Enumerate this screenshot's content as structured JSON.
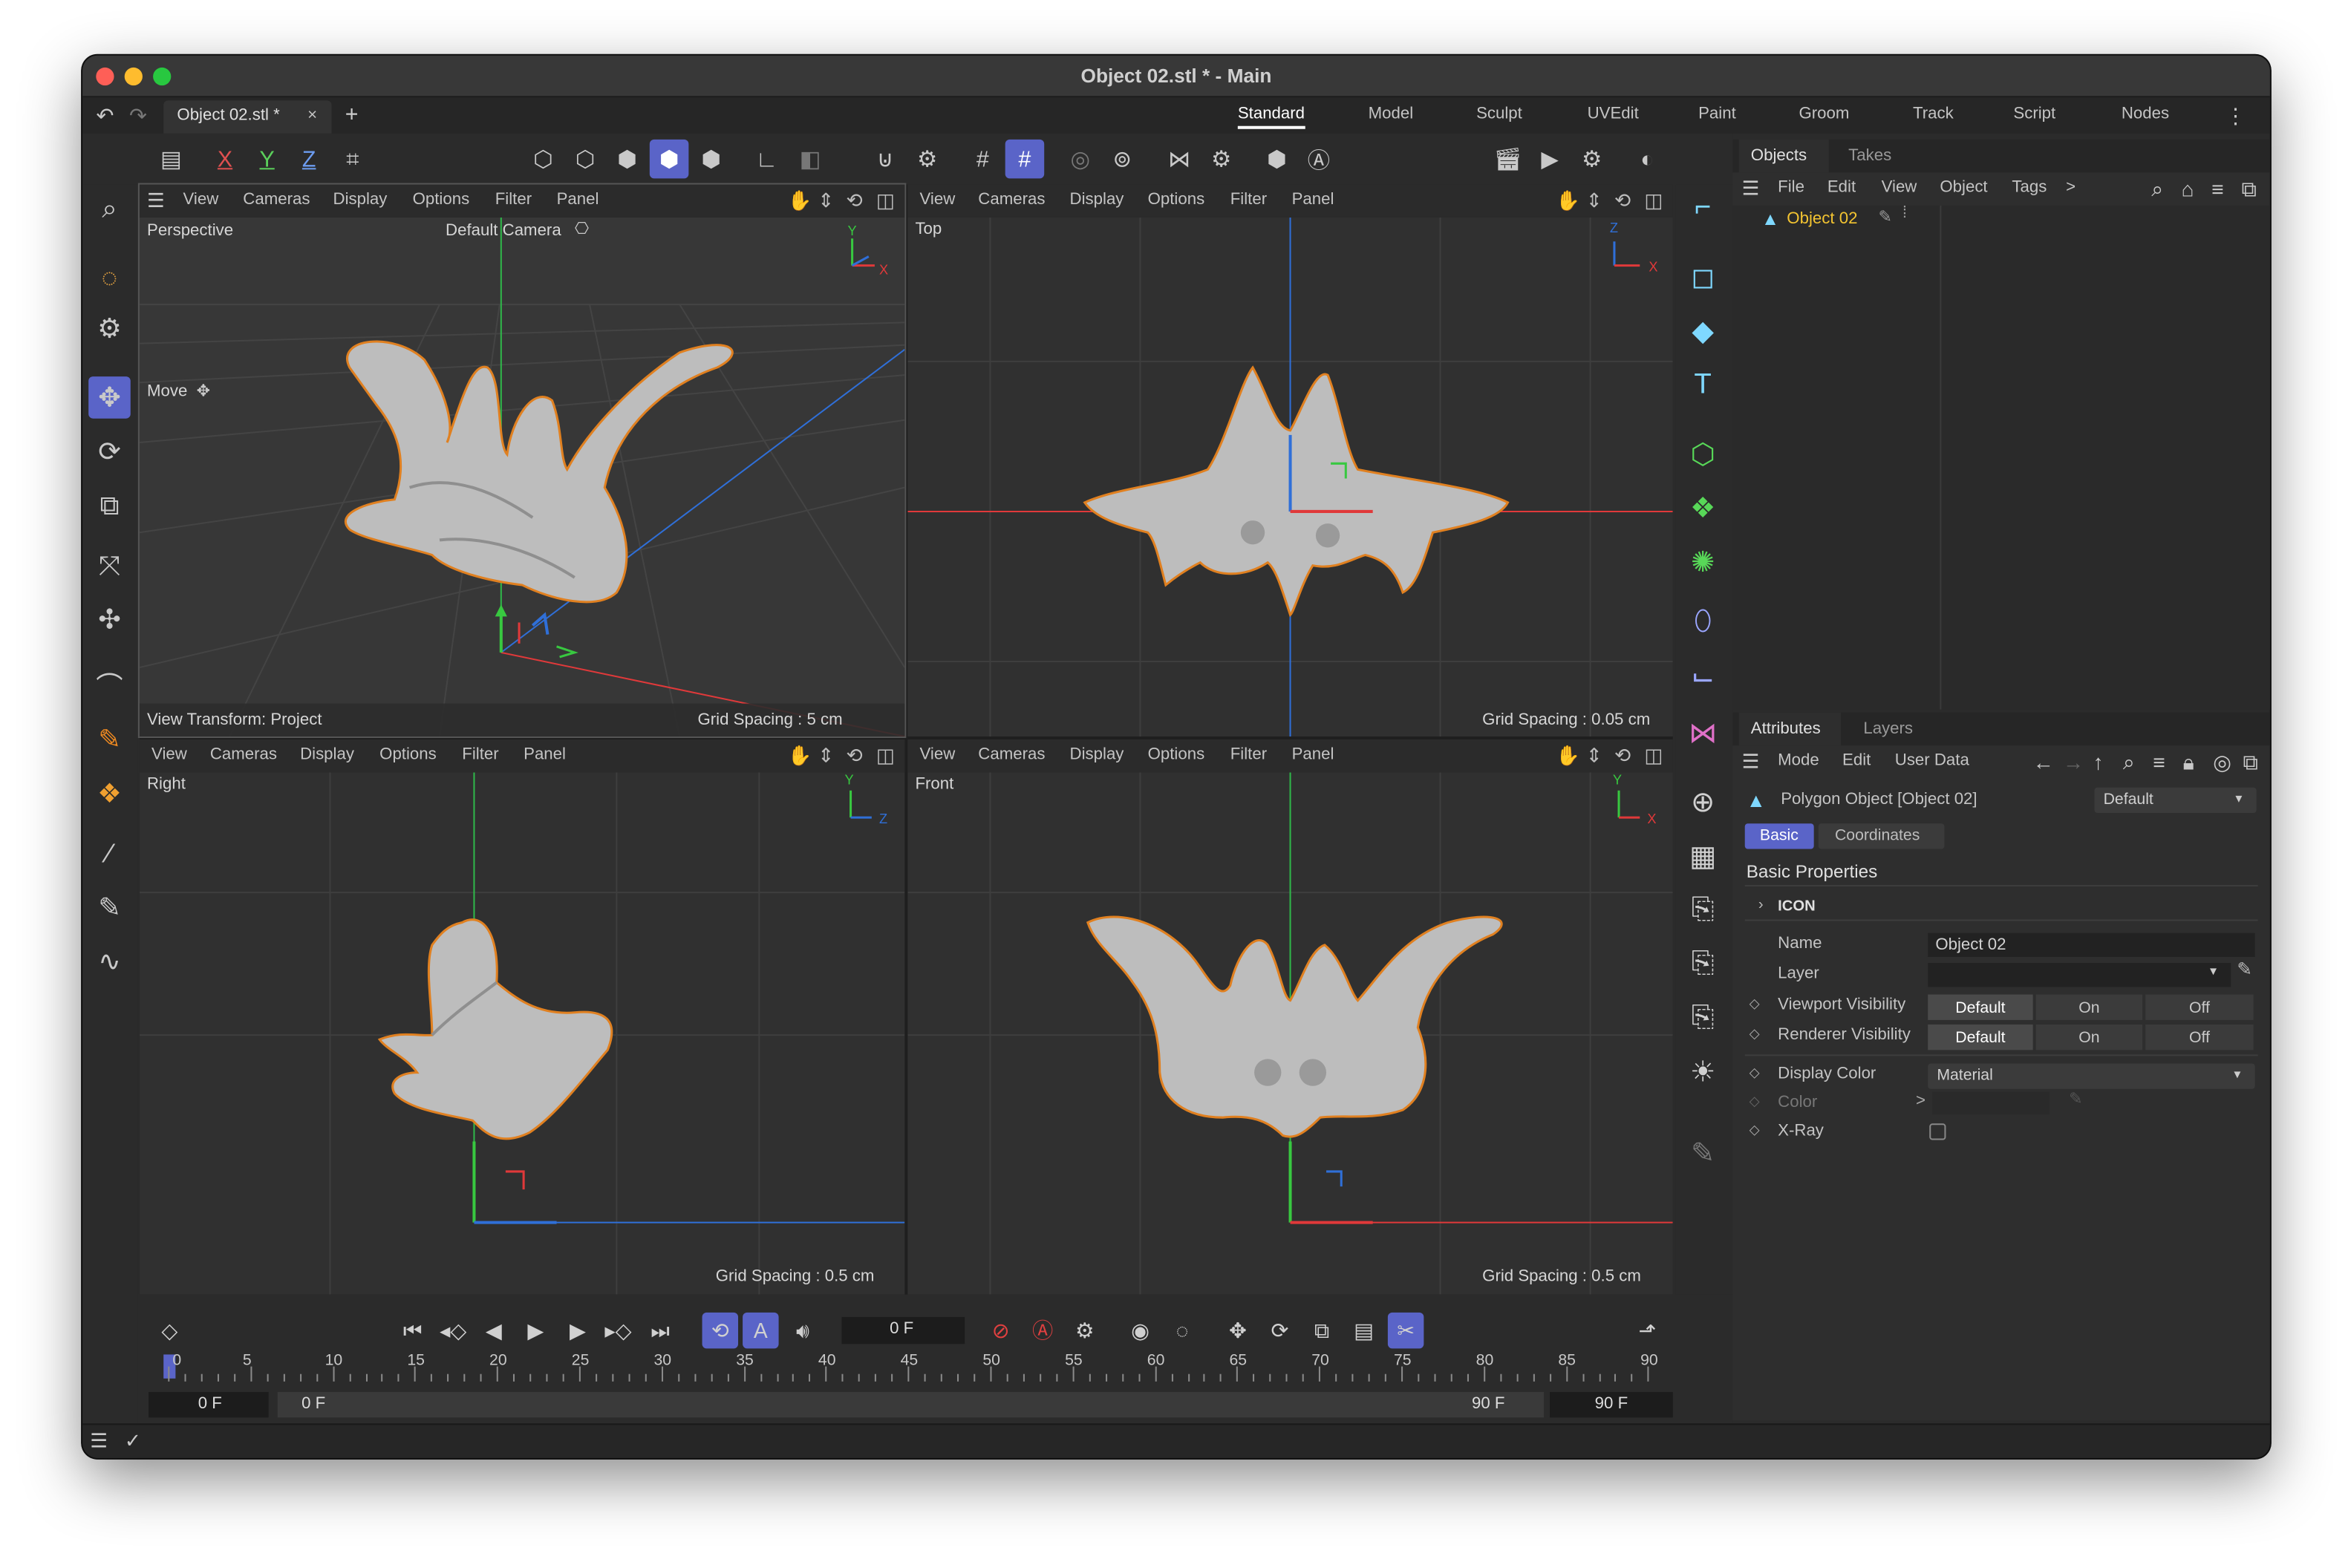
{
  "window": {
    "title": "Object 02.stl * - Main"
  },
  "tabs": {
    "doc_tab": "Object 02.stl *",
    "close": "×",
    "add": "+"
  },
  "layouts": [
    "Standard",
    "Model",
    "Sculpt",
    "UVEdit",
    "Paint",
    "Groom",
    "Track",
    "Script",
    "Nodes"
  ],
  "axis_buttons": [
    "X",
    "Y",
    "Z"
  ],
  "viewport_menu": [
    "View",
    "Cameras",
    "Display",
    "Options",
    "Filter",
    "Panel"
  ],
  "viewports": {
    "perspective": {
      "name": "Perspective",
      "camera": "Default Camera",
      "tool": "Move",
      "transform": "View Transform: Project",
      "grid": "Grid Spacing : 5 cm"
    },
    "top": {
      "name": "Top",
      "grid": "Grid Spacing : 0.05 cm"
    },
    "right": {
      "name": "Right",
      "grid": "Grid Spacing : 0.5 cm"
    },
    "front": {
      "name": "Front",
      "grid": "Grid Spacing : 0.5 cm"
    }
  },
  "axis_letters": {
    "x": "X",
    "y": "Y",
    "z": "Z"
  },
  "objects_panel": {
    "tabs": [
      "Objects",
      "Takes"
    ],
    "menu": [
      "File",
      "Edit",
      "View",
      "Object",
      "Tags"
    ],
    "more": ">",
    "items": [
      {
        "name": "Object 02"
      }
    ]
  },
  "attributes_panel": {
    "tabs": [
      "Attributes",
      "Layers"
    ],
    "menu": [
      "Mode",
      "Edit",
      "User Data"
    ],
    "object_title": "Polygon Object [Object 02]",
    "preset": "Default",
    "subtabs": [
      "Basic",
      "Coordinates"
    ],
    "section": "Basic Properties",
    "icon_group": "ICON",
    "fields": {
      "name_label": "Name",
      "name_value": "Object 02",
      "layer_label": "Layer",
      "viewport_vis_label": "Viewport Visibility",
      "renderer_vis_label": "Renderer Visibility",
      "vis_options": [
        "Default",
        "On",
        "Off"
      ],
      "display_color_label": "Display Color",
      "display_color_value": "Material",
      "color_label": "Color",
      "color_arrow": ">",
      "xray_label": "X-Ray"
    }
  },
  "timeline": {
    "current_frame": "0 F",
    "ticks": [
      "0",
      "5",
      "10",
      "15",
      "20",
      "25",
      "30",
      "35",
      "40",
      "45",
      "50",
      "55",
      "60",
      "65",
      "70",
      "75",
      "80",
      "85",
      "90"
    ],
    "start": "0 F",
    "range_start": "0 F",
    "range_end": "90 F",
    "end": "90 F"
  },
  "colors": {
    "accent": "#5a64c8",
    "x_axis": "#e0393a",
    "y_axis": "#38c840",
    "z_axis": "#2f6fd8",
    "selected_object": "#f3c431",
    "outline": "#e08020"
  }
}
